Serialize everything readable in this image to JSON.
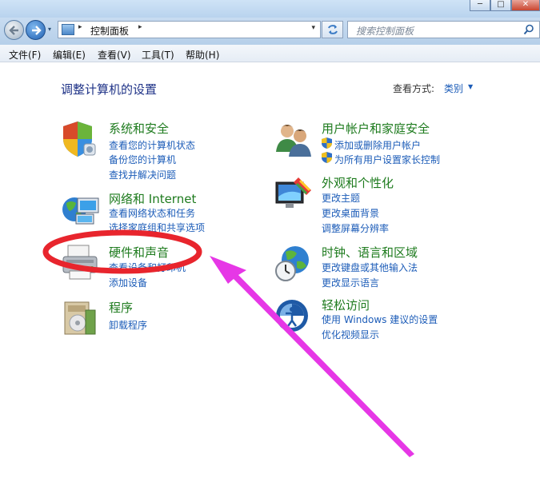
{
  "window": {
    "buttons": {
      "minimize": "─",
      "maximize": "□",
      "close": "✕"
    }
  },
  "address_bar": {
    "crumb": "控制面板",
    "separator": "▸",
    "dropdown": "▾"
  },
  "search": {
    "placeholder": "搜索控制面板"
  },
  "menu": {
    "file": "文件(F)",
    "edit": "编辑(E)",
    "view": "查看(V)",
    "tools": "工具(T)",
    "help": "帮助(H)"
  },
  "content": {
    "title": "调整计算机的设置",
    "view_by_label": "查看方式:",
    "view_by_value": "类别",
    "view_by_arrow": "▼"
  },
  "categories": {
    "system": {
      "title": "系统和安全",
      "links": [
        "查看您的计算机状态",
        "备份您的计算机",
        "查找并解决问题"
      ]
    },
    "network": {
      "title": "网络和 Internet",
      "links": [
        "查看网络状态和任务",
        "选择家庭组和共享选项"
      ]
    },
    "hardware": {
      "title": "硬件和声音",
      "links": [
        "查看设备和打印机",
        "添加设备"
      ]
    },
    "programs": {
      "title": "程序",
      "links": [
        "卸载程序"
      ]
    },
    "users": {
      "title": "用户帐户和家庭安全",
      "links": [
        "添加或删除用户帐户",
        "为所有用户设置家长控制"
      ]
    },
    "appearance": {
      "title": "外观和个性化",
      "links": [
        "更改主题",
        "更改桌面背景",
        "调整屏幕分辨率"
      ]
    },
    "clock": {
      "title": "时钟、语言和区域",
      "links": [
        "更改键盘或其他输入法",
        "更改显示语言"
      ]
    },
    "ease": {
      "title": "轻松访问",
      "links": [
        "使用 Windows 建议的设置",
        "优化视频显示"
      ]
    }
  },
  "colors": {
    "category_title": "#1e7b1e",
    "link": "#1c5cb8",
    "page_title": "#1e3287",
    "annotation_circle": "#e8252d",
    "annotation_arrow": "#e637e6"
  },
  "annotations": {
    "circle_target": "硬件和声音",
    "arrow_target": "硬件和声音"
  }
}
